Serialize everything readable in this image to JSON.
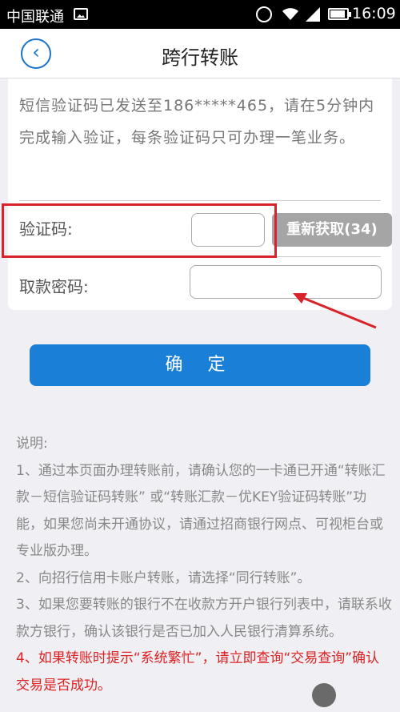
{
  "status_bar": {
    "carrier": "中国联通",
    "time": "16:09",
    "icons": [
      "image-icon",
      "alarm-icon",
      "wifi-icon",
      "signal-icon",
      "battery-icon"
    ]
  },
  "header": {
    "back_icon": "‹",
    "title": "跨行转账"
  },
  "sms_notice": "短信验证码已发送至186*****465，请在5分钟内完成输入验证，每条验证码只可办理一笔业务。",
  "form": {
    "code_label": "验证码:",
    "code_value": "",
    "resend_label": "重新获取(34)",
    "password_label": "取款密码:",
    "password_value": ""
  },
  "confirm_label": "确 定",
  "notes": {
    "heading": "说明:",
    "item1": "1、通过本页面办理转账前，请确认您的一卡通已开通“转账汇款－短信验证码转账” 或“转账汇款－优KEY验证码转账”功能，如果您尚未开通协议，请通过招商银行网点、可视柜台或专业版办理。",
    "item2": "2、向招行信用卡账户转账，请选择“同行转账”。",
    "item3": "3、如果您要转账的银行不在收款方开户银行列表中，请联系收款方银行，确认该银行是否已加入人民银行清算系统。",
    "item4_prefix": "4、",
    "item4": "如果转账时提示“系统繁忙”，请立即查询“交易查询”确认交易是否成功。"
  },
  "colors": {
    "accent": "#1a7fd6",
    "resend_bg": "#a5a5a5",
    "highlight": "#d9232a"
  }
}
